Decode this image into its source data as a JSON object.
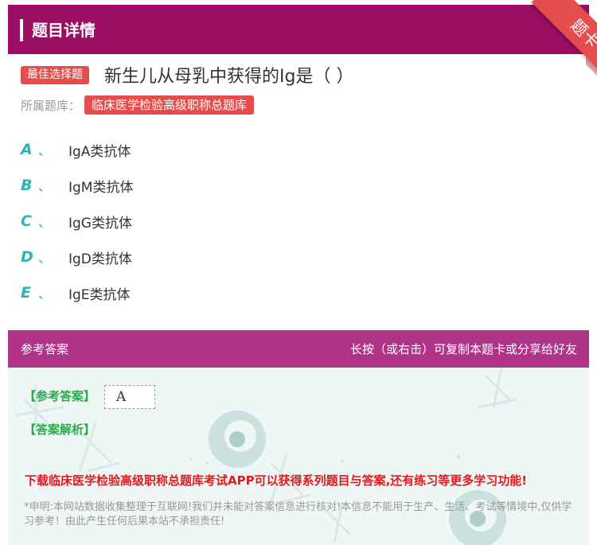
{
  "header": {
    "title": "题目详情"
  },
  "ribbon": {
    "label": "题卡"
  },
  "question": {
    "type_badge": "最佳选择题",
    "text": "新生儿从母乳中获得的Ig是（      ）",
    "bank_label": "所属题库：",
    "bank_name": "临床医学检验高级职称总题库"
  },
  "options": [
    {
      "letter": "A",
      "sep": "、",
      "text": "IgA类抗体"
    },
    {
      "letter": "B",
      "sep": "、",
      "text": "IgM类抗体"
    },
    {
      "letter": "C",
      "sep": "、",
      "text": "IgG类抗体"
    },
    {
      "letter": "D",
      "sep": "、",
      "text": "IgD类抗体"
    },
    {
      "letter": "E",
      "sep": "、",
      "text": "IgE类抗体"
    }
  ],
  "answer_bar": {
    "left": "参考答案",
    "right": "长按（或右击）可复制本题卡或分享给好友"
  },
  "answer": {
    "answer_label": "【参考答案】",
    "answer_value": "A",
    "analysis_label": "【答案解析】"
  },
  "promo": "下载临床医学检验高级职称总题库考试APP可以获得系列题目与答案,还有练习等更多学习功能!",
  "disclaimer": "*申明:本网站数据收集整理于互联网!我们并未能对答案信息进行核对!本信息不能用于生产、生活、考试等情境中,仅供学习参考！由此产生任何后果本站不承担责任!",
  "colors": {
    "header_bg": "#9b0e63",
    "answer_bar_bg": "#b0338a",
    "badge_red": "#e74c4c",
    "option_letter": "#2bb5b5",
    "answer_green": "#2daa4b",
    "promo_red": "#e3191d"
  }
}
